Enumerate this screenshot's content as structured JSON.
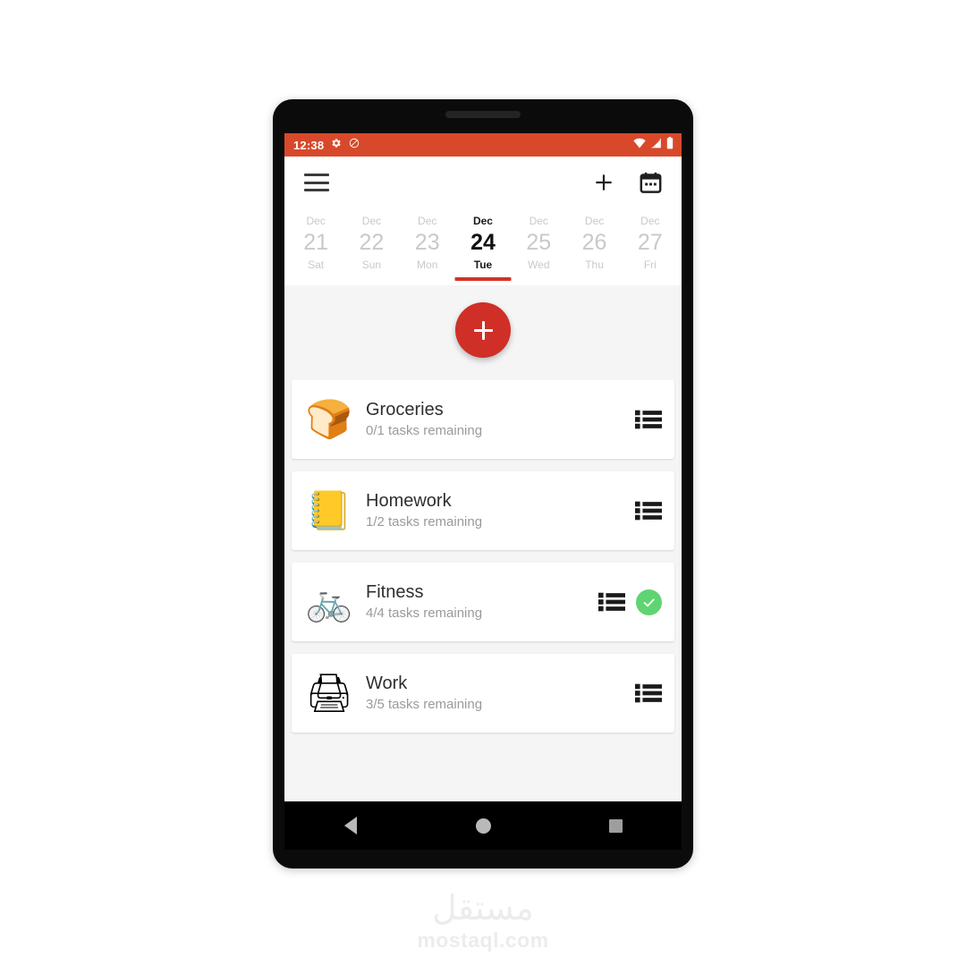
{
  "status_bar": {
    "time": "12:38",
    "left_icons": [
      "gear-icon",
      "do-not-disturb-icon"
    ],
    "right_icons": [
      "wifi-icon",
      "cell-signal-icon",
      "battery-icon"
    ],
    "background_color": "#d8492b"
  },
  "app_bar": {
    "menu_icon": "hamburger-menu-icon",
    "add_icon": "plus-icon",
    "calendar_icon": "calendar-icon"
  },
  "date_strip": {
    "days": [
      {
        "month": "Dec",
        "day": "21",
        "weekday": "Sat",
        "selected": false
      },
      {
        "month": "Dec",
        "day": "22",
        "weekday": "Sun",
        "selected": false
      },
      {
        "month": "Dec",
        "day": "23",
        "weekday": "Mon",
        "selected": false
      },
      {
        "month": "Dec",
        "day": "24",
        "weekday": "Tue",
        "selected": true
      },
      {
        "month": "Dec",
        "day": "25",
        "weekday": "Wed",
        "selected": false
      },
      {
        "month": "Dec",
        "day": "26",
        "weekday": "Thu",
        "selected": false
      },
      {
        "month": "Dec",
        "day": "27",
        "weekday": "Fri",
        "selected": false
      }
    ],
    "selected_indicator_color": "#d33226"
  },
  "fab": {
    "icon": "plus-icon",
    "color": "#cf2f27"
  },
  "task_lists": [
    {
      "emoji": "🍞",
      "emoji_name": "bread-emoji",
      "title": "Groceries",
      "subtitle": "0/1 tasks remaining",
      "list_icon": "list-view-icon",
      "completed": false
    },
    {
      "emoji": "📒",
      "emoji_name": "notebook-emoji",
      "title": "Homework",
      "subtitle": "1/2 tasks remaining",
      "list_icon": "list-view-icon",
      "completed": false
    },
    {
      "emoji": "🚲",
      "emoji_name": "bicycle-emoji",
      "title": "Fitness",
      "subtitle": "4/4 tasks remaining",
      "list_icon": "list-view-icon",
      "completed": true,
      "badge_color": "#5fd472"
    },
    {
      "emoji": "🖨",
      "emoji_name": "printer-emoji",
      "title": "Work",
      "subtitle": "3/5 tasks remaining",
      "list_icon": "list-view-icon",
      "completed": false
    }
  ],
  "nav_bar": {
    "back_icon": "back-triangle-icon",
    "home_icon": "home-circle-icon",
    "recents_icon": "recents-square-icon"
  },
  "watermark": {
    "arabic": "مستقل",
    "latin": "mostaql.com"
  }
}
